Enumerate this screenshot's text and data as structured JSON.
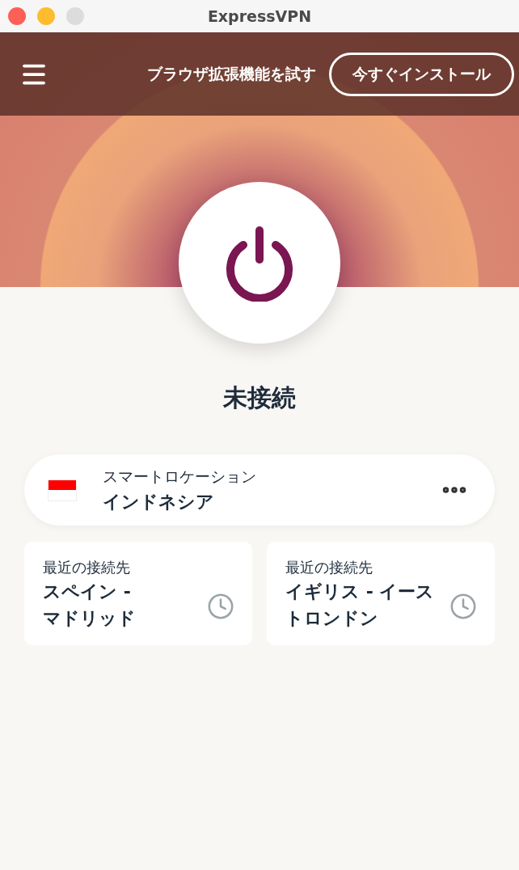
{
  "window": {
    "title": "ExpressVPN"
  },
  "banner": {
    "text": "ブラウザ拡張機能を試す",
    "button": "今すぐインストール"
  },
  "status": {
    "text": "未接続",
    "connected": false
  },
  "location": {
    "label": "スマートロケーション",
    "name": "インドネシア"
  },
  "recent": [
    {
      "label": "最近の接続先",
      "lines": [
        "スペイン -",
        "マドリッド"
      ]
    },
    {
      "label": "最近の接続先",
      "lines": [
        "イギリス - イース",
        "トロンドン"
      ]
    }
  ]
}
